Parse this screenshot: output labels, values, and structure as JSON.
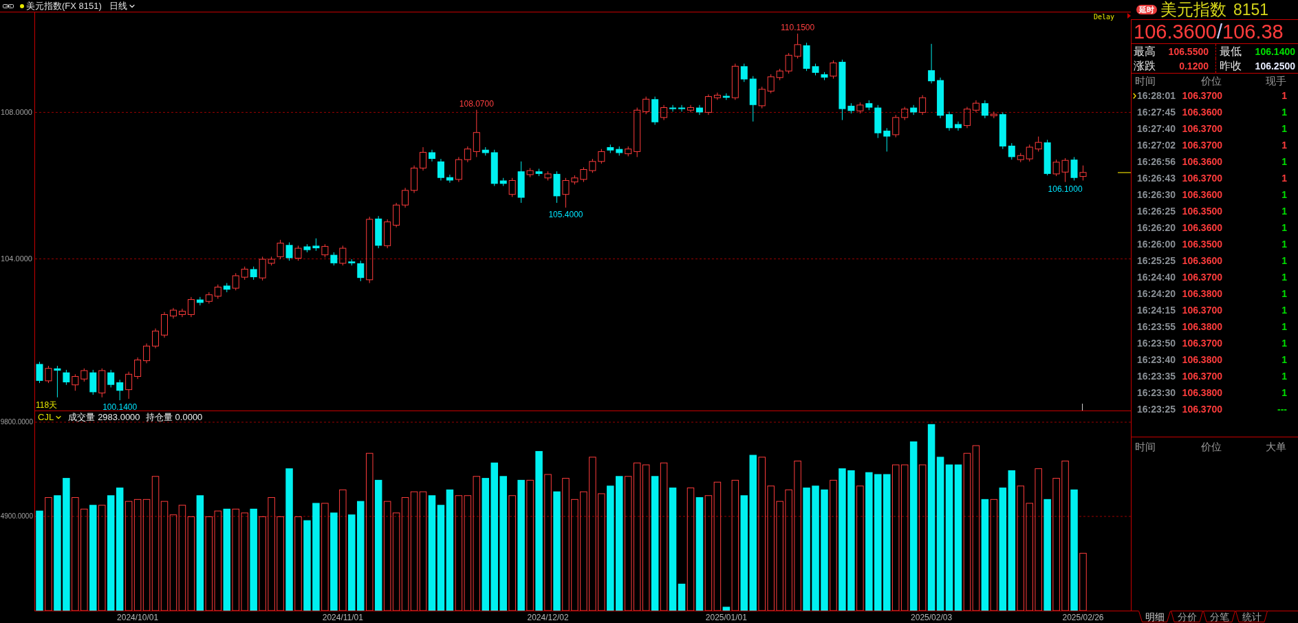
{
  "header": {
    "title": "美元指数(FX 8151)",
    "period": "日线"
  },
  "main_chart": {
    "delay_label": "Delay",
    "period_label": "118天",
    "chart_data": {
      "type": "candlestick",
      "categories": [
        null,
        null,
        null,
        null,
        null,
        null,
        null,
        null,
        null,
        null,
        null,
        null,
        null,
        null,
        null,
        null,
        null,
        null,
        null,
        null,
        null,
        null,
        null,
        null,
        null,
        null,
        null,
        null,
        null,
        null,
        null,
        null,
        null,
        null,
        null,
        null,
        null,
        null,
        null,
        null,
        null,
        null,
        null,
        null,
        null,
        null,
        null,
        null,
        null,
        null,
        null,
        null,
        null,
        null,
        null,
        null,
        null,
        null,
        null,
        null,
        null,
        null,
        null,
        null,
        null,
        null,
        null,
        null,
        null,
        null,
        null,
        null,
        null,
        null,
        null,
        null,
        null,
        null,
        null,
        null,
        null,
        null,
        null,
        null,
        null,
        null,
        null,
        null,
        null,
        null,
        null,
        null,
        null,
        null,
        null,
        null,
        null,
        null,
        null,
        null,
        null,
        null,
        null,
        null,
        null,
        null,
        null,
        null,
        null,
        null,
        null,
        null,
        null,
        null,
        null,
        null,
        null,
        null
      ],
      "ohlc": [
        [
          101.13,
          101.19,
          100.61,
          100.67
        ],
        [
          100.67,
          101.08,
          100.61,
          101.01
        ],
        [
          101.01,
          101.08,
          100.22,
          100.95
        ],
        [
          100.9,
          100.97,
          100.56,
          100.63
        ],
        [
          100.56,
          100.85,
          100.4,
          100.79
        ],
        [
          100.72,
          101.01,
          100.65,
          100.95
        ],
        [
          100.9,
          100.97,
          100.29,
          100.36
        ],
        [
          100.34,
          101.01,
          100.22,
          100.95
        ],
        [
          100.9,
          100.97,
          100.49,
          100.56
        ],
        [
          100.63,
          100.7,
          100.14,
          100.4
        ],
        [
          100.43,
          100.92,
          100.18,
          100.85
        ],
        [
          100.79,
          101.31,
          100.72,
          101.24
        ],
        [
          101.22,
          101.69,
          101.15,
          101.62
        ],
        [
          101.62,
          102.1,
          101.56,
          102.03
        ],
        [
          101.92,
          102.55,
          101.85,
          102.48
        ],
        [
          102.44,
          102.66,
          102.37,
          102.6
        ],
        [
          102.48,
          102.64,
          102.41,
          102.57
        ],
        [
          102.48,
          102.96,
          102.41,
          102.89
        ],
        [
          102.89,
          102.96,
          102.73,
          102.8
        ],
        [
          102.84,
          103.09,
          102.78,
          103.02
        ],
        [
          102.98,
          103.3,
          102.91,
          103.23
        ],
        [
          103.27,
          103.34,
          103.09,
          103.16
        ],
        [
          103.2,
          103.61,
          103.14,
          103.54
        ],
        [
          103.5,
          103.79,
          103.43,
          103.72
        ],
        [
          103.72,
          103.79,
          103.43,
          103.5
        ],
        [
          103.48,
          104.06,
          103.41,
          103.99
        ],
        [
          103.88,
          104.06,
          103.82,
          103.99
        ],
        [
          104.06,
          104.52,
          103.99,
          104.43
        ],
        [
          104.38,
          104.45,
          103.95,
          104.02
        ],
        [
          104.02,
          104.36,
          103.95,
          104.29
        ],
        [
          104.34,
          104.4,
          104.18,
          104.24
        ],
        [
          104.36,
          104.56,
          104.22,
          104.29
        ],
        [
          104.11,
          104.4,
          104.04,
          104.34
        ],
        [
          104.11,
          104.18,
          103.82,
          103.88
        ],
        [
          103.88,
          104.36,
          103.82,
          104.29
        ],
        [
          103.93,
          103.99,
          103.82,
          103.88
        ],
        [
          103.88,
          103.95,
          103.39,
          103.48
        ],
        [
          103.43,
          105.15,
          103.34,
          105.08
        ],
        [
          105.1,
          105.17,
          104.29,
          104.36
        ],
        [
          104.36,
          105.08,
          104.29,
          105.01
        ],
        [
          104.92,
          105.53,
          104.86,
          105.47
        ],
        [
          105.47,
          105.94,
          105.4,
          105.87
        ],
        [
          105.87,
          106.55,
          105.8,
          106.48
        ],
        [
          106.48,
          107.05,
          106.41,
          106.91
        ],
        [
          106.91,
          106.98,
          106.66,
          106.73
        ],
        [
          106.66,
          106.73,
          106.14,
          106.21
        ],
        [
          106.23,
          106.3,
          106.08,
          106.14
        ],
        [
          106.17,
          106.78,
          106.1,
          106.71
        ],
        [
          106.71,
          107.07,
          106.64,
          107.0
        ],
        [
          106.93,
          108.07,
          106.78,
          107.45
        ],
        [
          106.98,
          107.05,
          106.82,
          106.89
        ],
        [
          106.91,
          106.98,
          105.99,
          106.05
        ],
        [
          106.14,
          106.21,
          105.99,
          106.05
        ],
        [
          105.76,
          106.21,
          105.69,
          106.14
        ],
        [
          106.39,
          106.66,
          105.53,
          105.67
        ],
        [
          106.3,
          106.48,
          106.23,
          106.41
        ],
        [
          106.39,
          106.46,
          106.26,
          106.32
        ],
        [
          106.21,
          106.39,
          106.14,
          106.32
        ],
        [
          106.32,
          106.39,
          105.53,
          105.71
        ],
        [
          105.76,
          106.21,
          105.4,
          106.14
        ],
        [
          106.1,
          106.28,
          106.03,
          106.21
        ],
        [
          106.17,
          106.5,
          106.1,
          106.44
        ],
        [
          106.41,
          106.73,
          106.35,
          106.66
        ],
        [
          106.66,
          107.0,
          106.6,
          106.93
        ],
        [
          107.05,
          107.12,
          106.89,
          106.96
        ],
        [
          107.0,
          107.07,
          106.82,
          106.89
        ],
        [
          106.87,
          107.07,
          106.8,
          107.0
        ],
        [
          106.93,
          108.13,
          106.78,
          108.06
        ],
        [
          108.02,
          108.43,
          107.95,
          108.36
        ],
        [
          108.36,
          108.43,
          107.66,
          107.73
        ],
        [
          107.86,
          108.2,
          107.79,
          108.13
        ],
        [
          108.13,
          108.2,
          108.02,
          108.09
        ],
        [
          108.13,
          108.2,
          108.02,
          108.09
        ],
        [
          108.06,
          108.2,
          108.0,
          108.13
        ],
        [
          108.13,
          108.2,
          107.93,
          108.0
        ],
        [
          108.0,
          108.49,
          107.93,
          108.43
        ],
        [
          108.4,
          108.54,
          108.34,
          108.47
        ],
        [
          108.45,
          108.52,
          108.34,
          108.4
        ],
        [
          108.4,
          109.33,
          108.34,
          109.26
        ],
        [
          109.26,
          109.33,
          108.83,
          108.9
        ],
        [
          108.92,
          108.99,
          107.75,
          108.2
        ],
        [
          108.18,
          108.7,
          108.11,
          108.63
        ],
        [
          108.58,
          109.04,
          108.52,
          108.97
        ],
        [
          108.95,
          109.19,
          108.88,
          109.13
        ],
        [
          109.13,
          109.62,
          109.06,
          109.56
        ],
        [
          109.53,
          110.15,
          109.47,
          109.85
        ],
        [
          109.83,
          109.9,
          109.13,
          109.19
        ],
        [
          109.26,
          109.33,
          109.01,
          109.08
        ],
        [
          109.04,
          109.1,
          108.88,
          108.95
        ],
        [
          108.99,
          109.42,
          108.92,
          109.35
        ],
        [
          109.38,
          109.44,
          107.79,
          108.09
        ],
        [
          108.18,
          108.25,
          107.97,
          108.04
        ],
        [
          108.04,
          108.27,
          107.97,
          108.2
        ],
        [
          108.25,
          108.33,
          108.06,
          108.13
        ],
        [
          108.13,
          108.2,
          107.3,
          107.43
        ],
        [
          107.5,
          107.57,
          106.93,
          107.34
        ],
        [
          107.39,
          107.93,
          107.32,
          107.86
        ],
        [
          107.86,
          108.15,
          107.79,
          108.09
        ],
        [
          108.13,
          108.2,
          107.93,
          108.0
        ],
        [
          108.0,
          108.47,
          107.93,
          108.4
        ],
        [
          109.15,
          109.87,
          108.79,
          108.85
        ],
        [
          108.88,
          108.95,
          107.84,
          107.91
        ],
        [
          107.95,
          108.02,
          107.5,
          107.57
        ],
        [
          107.68,
          107.75,
          107.5,
          107.57
        ],
        [
          107.64,
          108.15,
          107.57,
          108.09
        ],
        [
          108.06,
          108.33,
          108.0,
          108.25
        ],
        [
          108.25,
          108.33,
          107.84,
          107.91
        ],
        [
          107.91,
          108.02,
          107.84,
          107.95
        ],
        [
          107.95,
          108.0,
          107.0,
          107.07
        ],
        [
          107.09,
          107.16,
          106.71,
          106.78
        ],
        [
          106.71,
          106.89,
          106.64,
          106.82
        ],
        [
          106.73,
          107.12,
          106.66,
          107.05
        ],
        [
          107.0,
          107.34,
          106.93,
          107.18
        ],
        [
          107.18,
          107.25,
          106.28,
          106.32
        ],
        [
          106.32,
          106.71,
          106.26,
          106.64
        ],
        [
          106.37,
          106.75,
          106.1,
          106.69
        ],
        [
          106.71,
          106.78,
          106.14,
          106.21
        ],
        [
          106.25,
          106.55,
          106.14,
          106.36
        ]
      ],
      "ylim": [
        99.86,
        110.73
      ],
      "yticks": [
        {
          "value": 108,
          "label": "108.0000"
        },
        {
          "value": 104,
          "label": "104.0000"
        }
      ],
      "annotations": [
        "110.1500",
        "108.0700",
        "106.1000",
        "105.4000",
        "100.1400"
      ]
    }
  },
  "volume_panel": {
    "indicator": "CJL",
    "stats": [
      {
        "label": "成交量",
        "value": "2983.0000"
      },
      {
        "label": "持仓量",
        "value": "0.0000"
      }
    ],
    "chart_data": {
      "type": "bar",
      "stacked": true,
      "categories": [
        null,
        null,
        null,
        null,
        null,
        null,
        null,
        null,
        null,
        null,
        null,
        "2024/10/01",
        null,
        null,
        null,
        null,
        null,
        null,
        null,
        null,
        null,
        null,
        null,
        null,
        null,
        null,
        null,
        null,
        null,
        null,
        null,
        null,
        null,
        null,
        "2024/11/01",
        null,
        null,
        null,
        null,
        null,
        null,
        null,
        null,
        null,
        null,
        null,
        null,
        null,
        null,
        null,
        null,
        null,
        null,
        null,
        null,
        null,
        null,
        "2024/12/02",
        null,
        null,
        null,
        null,
        null,
        null,
        null,
        null,
        null,
        null,
        null,
        null,
        null,
        null,
        null,
        null,
        null,
        null,
        null,
        "2025/01/01",
        null,
        null,
        null,
        null,
        null,
        null,
        null,
        null,
        null,
        null,
        null,
        null,
        null,
        null,
        null,
        null,
        null,
        null,
        null,
        null,
        null,
        null,
        "2025/02/03",
        null,
        null,
        null,
        null,
        null,
        null,
        null,
        null,
        null,
        null,
        null,
        null,
        null,
        null,
        null,
        null,
        "2025/02/26"
      ],
      "ylim": [
        0,
        10372
      ],
      "yticks": [
        {
          "value": 9800,
          "label": "9800.0000"
        },
        {
          "value": 4900,
          "label": "4900.0000"
        }
      ],
      "series": [
        {
          "color": "#00f0f0",
          "values": [
            5200,
            null,
            6000,
            6900,
            null,
            null,
            5500,
            null,
            6000,
            6400,
            null,
            null,
            null,
            null,
            null,
            null,
            null,
            null,
            6000,
            null,
            null,
            5300,
            null,
            null,
            5300,
            null,
            null,
            null,
            7400,
            null,
            4700,
            5600,
            null,
            5100,
            null,
            5000,
            5700,
            null,
            6800,
            null,
            null,
            null,
            null,
            null,
            6000,
            5500,
            6300,
            null,
            null,
            null,
            6900,
            7700,
            7000,
            null,
            6800,
            null,
            8300,
            null,
            6200,
            null,
            null,
            null,
            null,
            null,
            6500,
            7000,
            null,
            null,
            null,
            7000,
            null,
            6400,
            1400,
            null,
            5900,
            null,
            null,
            200,
            null,
            6000,
            8100,
            null,
            null,
            null,
            null,
            null,
            6400,
            6500,
            6300,
            null,
            7400,
            7300,
            null,
            7200,
            7100,
            7100,
            null,
            null,
            8800,
            null,
            9700,
            8000,
            7600,
            7600,
            null,
            null,
            5800,
            null,
            6400,
            7300,
            null,
            null,
            null,
            5800,
            null,
            null,
            6300,
            null
          ]
        },
        {
          "color": "#ff3c3c",
          "values": [
            null,
            5900,
            null,
            null,
            5900,
            5300,
            null,
            5500,
            null,
            null,
            5700,
            5800,
            5800,
            7000,
            5700,
            5000,
            5500,
            4900,
            null,
            4900,
            5200,
            null,
            5300,
            5100,
            null,
            4900,
            5900,
            4900,
            null,
            4900,
            null,
            null,
            5600,
            null,
            6300,
            null,
            null,
            8200,
            null,
            5700,
            5100,
            5900,
            6200,
            6200,
            null,
            null,
            null,
            6000,
            6000,
            7000,
            null,
            null,
            null,
            6000,
            null,
            6800,
            null,
            7100,
            null,
            6900,
            5800,
            6200,
            8000,
            6100,
            null,
            null,
            7000,
            7700,
            7600,
            null,
            7700,
            null,
            null,
            6400,
            null,
            6000,
            6700,
            null,
            6800,
            null,
            null,
            8000,
            6500,
            5700,
            6300,
            7800,
            null,
            null,
            null,
            6800,
            null,
            null,
            6500,
            null,
            null,
            null,
            7600,
            7600,
            null,
            7600,
            null,
            null,
            null,
            null,
            8200,
            8600,
            null,
            5800,
            null,
            null,
            6500,
            5600,
            7400,
            null,
            6900,
            7800,
            null,
            3000
          ]
        }
      ]
    }
  },
  "quote": {
    "badge": "延时",
    "name": "美元指数",
    "code": "8151",
    "price": "106.3600",
    "separator": "/",
    "price_2": "106.38",
    "stats": [
      {
        "label": "最高",
        "value": "106.5500",
        "color": "#ff3c3c"
      },
      {
        "label": "最低",
        "value": "106.1400",
        "color": "#00e000"
      },
      {
        "label": "涨跌",
        "value": "0.1200",
        "color": "#ff3c3c"
      },
      {
        "label": "昨收",
        "value": "106.2500",
        "color": "#e8ecff"
      }
    ]
  },
  "trades": {
    "columns": [
      "时间",
      "价位",
      "现手"
    ],
    "rows": [
      {
        "time": "16:28:01",
        "price": "106.3700",
        "volume": "1",
        "color": "#ff3c3c",
        "selected": true
      },
      {
        "time": "16:27:45",
        "price": "106.3600",
        "volume": "1",
        "color": "#00e000",
        "selected": false
      },
      {
        "time": "16:27:40",
        "price": "106.3700",
        "volume": "1",
        "color": "#00e000",
        "selected": false
      },
      {
        "time": "16:27:02",
        "price": "106.3700",
        "volume": "1",
        "color": "#ff3c3c",
        "selected": false
      },
      {
        "time": "16:26:56",
        "price": "106.3600",
        "volume": "1",
        "color": "#00e000",
        "selected": false
      },
      {
        "time": "16:26:43",
        "price": "106.3700",
        "volume": "1",
        "color": "#ff3c3c",
        "selected": false
      },
      {
        "time": "16:26:30",
        "price": "106.3600",
        "volume": "1",
        "color": "#00e000",
        "selected": false
      },
      {
        "time": "16:26:25",
        "price": "106.3500",
        "volume": "1",
        "color": "#00e000",
        "selected": false
      },
      {
        "time": "16:26:20",
        "price": "106.3600",
        "volume": "1",
        "color": "#00e000",
        "selected": false
      },
      {
        "time": "16:26:00",
        "price": "106.3500",
        "volume": "1",
        "color": "#00e000",
        "selected": false
      },
      {
        "time": "16:25:25",
        "price": "106.3600",
        "volume": "1",
        "color": "#00e000",
        "selected": false
      },
      {
        "time": "16:24:40",
        "price": "106.3700",
        "volume": "1",
        "color": "#00e000",
        "selected": false
      },
      {
        "time": "16:24:20",
        "price": "106.3800",
        "volume": "1",
        "color": "#00e000",
        "selected": false
      },
      {
        "time": "16:24:15",
        "price": "106.3700",
        "volume": "1",
        "color": "#00e000",
        "selected": false
      },
      {
        "time": "16:23:55",
        "price": "106.3800",
        "volume": "1",
        "color": "#00e000",
        "selected": false
      },
      {
        "time": "16:23:50",
        "price": "106.3700",
        "volume": "1",
        "color": "#00e000",
        "selected": false
      },
      {
        "time": "16:23:40",
        "price": "106.3800",
        "volume": "1",
        "color": "#00e000",
        "selected": false
      },
      {
        "time": "16:23:35",
        "price": "106.3700",
        "volume": "1",
        "color": "#00e000",
        "selected": false
      },
      {
        "time": "16:23:30",
        "price": "106.3800",
        "volume": "1",
        "color": "#00e000",
        "selected": false
      },
      {
        "time": "16:23:25",
        "price": "106.3700",
        "volume": "---",
        "color": "#00e000",
        "selected": false
      }
    ]
  },
  "big_orders": {
    "columns": [
      "时间",
      "价位",
      "大单"
    ]
  },
  "tabs": [
    {
      "label": "明细",
      "selected": true
    },
    {
      "label": "分价",
      "selected": false
    },
    {
      "label": "分笔",
      "selected": false
    },
    {
      "label": "统计",
      "selected": false
    }
  ]
}
